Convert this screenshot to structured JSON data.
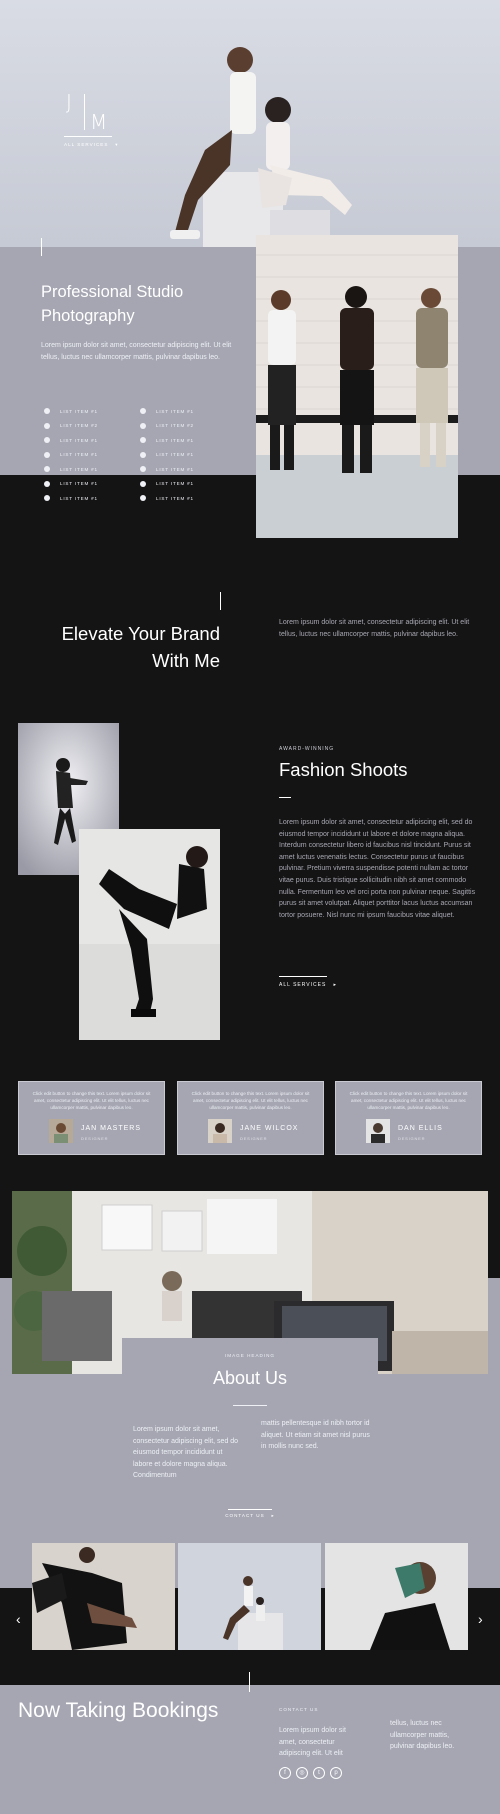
{
  "hero": {
    "logo_j": "J",
    "logo_m": "M",
    "services_menu": "ALL SERVICES"
  },
  "intro": {
    "title_line1": "Professional Studio",
    "title_line2": "Photography",
    "text": "Lorem ipsum dolor sit amet, consectetur adipiscing elit. Ut elit tellus, luctus nec ullamcorper mattis, pulvinar dapibus leo.",
    "list_left": [
      "LIST ITEM #1",
      "LIST ITEM #2",
      "LIST ITEM #1",
      "LIST ITEM #1",
      "LIST ITEM #1",
      "LIST ITEM #1",
      "LIST ITEM #1"
    ],
    "list_right": [
      "LIST ITEM #1",
      "LIST ITEM #2",
      "LIST ITEM #1",
      "LIST ITEM #1",
      "LIST ITEM #1",
      "LIST ITEM #1",
      "LIST ITEM #1"
    ]
  },
  "brand": {
    "title_line1": "Elevate Your Brand",
    "title_line2": "With Me",
    "text": "Lorem ipsum dolor sit amet, consectetur adipiscing elit. Ut elit tellus, luctus nec ullamcorper mattis, pulvinar dapibus leo."
  },
  "fashion": {
    "eyebrow": "AWARD-WINNING",
    "title": "Fashion Shoots",
    "text": "Lorem ipsum dolor sit amet, consectetur adipiscing elit, sed do eiusmod tempor incididunt ut labore et dolore magna aliqua. Interdum consectetur libero id faucibus nisl tincidunt. Purus sit amet luctus venenatis lectus. Consectetur purus ut faucibus pulvinar. Pretium viverra suspendisse potenti nullam ac tortor vitae purus. Duis tristique sollicitudin nibh sit amet commodo nulla. Fermentum leo vel orci porta non pulvinar neque. Sagittis purus sit amet volutpat. Aliquet porttitor lacus luctus accumsan tortor posuere. Nisl nunc mi ipsum faucibus vitae aliquet.",
    "link": "ALL SERVICES"
  },
  "testimonials": [
    {
      "quote": "Click edit button to change this text. Lorem ipsum dolor sit amet, consectetur adipiscing elit. Ut elit tellus, luctus nec ullamcorper mattis, pulvinar dapibus leo.",
      "name": "JAN MASTERS",
      "role": "DESIGNER"
    },
    {
      "quote": "Click edit button to change this text. Lorem ipsum dolor sit amet, consectetur adipiscing elit. Ut elit tellus, luctus nec ullamcorper mattis, pulvinar dapibus leo.",
      "name": "JANE WILCOX",
      "role": "DESIGNER"
    },
    {
      "quote": "Click edit button to change this text. Lorem ipsum dolor sit amet, consectetur adipiscing elit. Ut elit tellus, luctus nec ullamcorper mattis, pulvinar dapibus leo.",
      "name": "DAN ELLIS",
      "role": "DESIGNER"
    }
  ],
  "about": {
    "eyebrow": "IMAGE HEADING",
    "title": "About Us",
    "col1": "Lorem ipsum dolor sit amet, consectetur adipiscing elit, sed do eiusmod tempor incididunt ut labore et dolore magna aliqua. Condimentum",
    "col2": "mattis pellentesque id nibh tortor id aliquet. Ut etiam sit amet nisl purus in mollis nunc sed.",
    "cta": "CONTACT US"
  },
  "gallery": {
    "prev": "‹",
    "next": "›"
  },
  "footer": {
    "title": "Now Taking Bookings",
    "label": "CONTACT US",
    "col1": "Lorem ipsum dolor sit amet, consectetur adipiscing elit. Ut elit",
    "col2": "tellus, luctus nec ullamcorper mattis, pulvinar dapibus leo.",
    "socials": [
      "facebook-icon",
      "instagram-icon",
      "twitter-icon",
      "pinterest-icon"
    ]
  },
  "colors": {
    "dark": "#141414",
    "lavender": "#a5a6b2",
    "hero_bg": "#cfd3dc",
    "text_light": "#eef0f5"
  }
}
